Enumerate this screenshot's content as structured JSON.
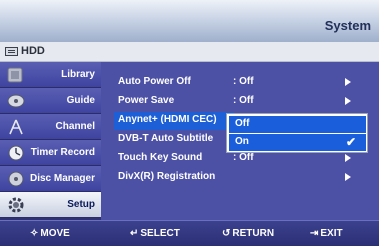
{
  "header": {
    "title": "System"
  },
  "subbar": {
    "label": "HDD"
  },
  "sidebar": {
    "items": [
      {
        "label": "Library",
        "icon": "library-icon"
      },
      {
        "label": "Guide",
        "icon": "disc-guide-icon"
      },
      {
        "label": "Channel",
        "icon": "antenna-icon"
      },
      {
        "label": "Timer Record",
        "icon": "clock-icon"
      },
      {
        "label": "Disc Manager",
        "icon": "disc-icon"
      },
      {
        "label": "Setup",
        "icon": "gear-icon"
      }
    ]
  },
  "settings": {
    "rows": [
      {
        "name": "Auto Power Off",
        "value": ": Off"
      },
      {
        "name": "Power Save",
        "value": ": Off"
      },
      {
        "name": "Anynet+ (HDMI CEC)",
        "value": ""
      },
      {
        "name": "DVB-T Auto Subtitle",
        "value": ""
      },
      {
        "name": "Touch Key Sound",
        "value": ": Off"
      },
      {
        "name": "DivX(R) Registration",
        "value": ""
      }
    ]
  },
  "popup": {
    "options": [
      "Off",
      "On"
    ],
    "checked_option": "On"
  },
  "footer": {
    "move": "MOVE",
    "select": "SELECT",
    "return": "RETURN",
    "exit": "EXIT"
  },
  "colors": {
    "background": "#4c51a6",
    "highlight": "#1b5edb",
    "header": "#c9d4e6"
  }
}
